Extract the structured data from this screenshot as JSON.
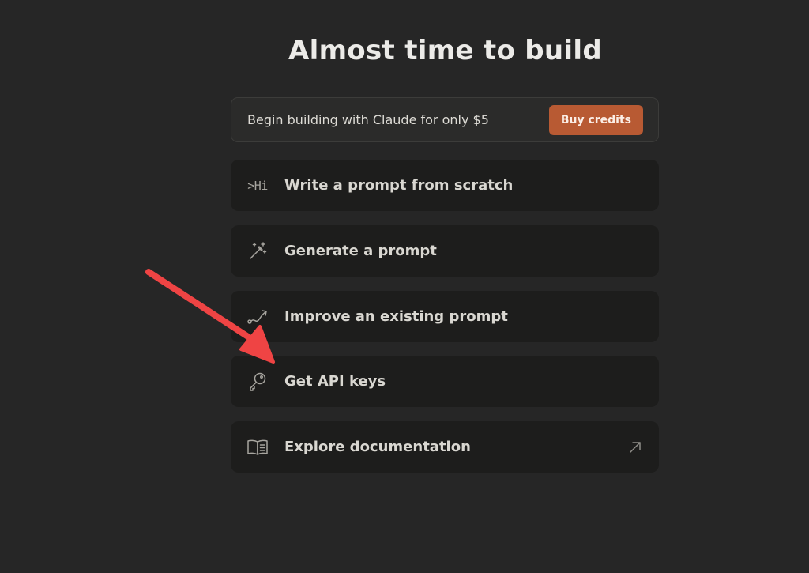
{
  "header": {
    "title": "Almost time to build"
  },
  "credits_banner": {
    "text": "Begin building with Claude for only $5",
    "button_label": "Buy credits",
    "button_color": "#b85a33"
  },
  "actions": [
    {
      "label": "Write a prompt from scratch",
      "icon": "terminal-hi-icon",
      "icon_text": ">Hi"
    },
    {
      "label": "Generate a prompt",
      "icon": "magic-wand-icon"
    },
    {
      "label": "Improve an existing prompt",
      "icon": "curve-path-icon"
    },
    {
      "label": "Get API keys",
      "icon": "key-icon"
    },
    {
      "label": "Explore documentation",
      "icon": "book-icon",
      "trailing_icon": "external-arrow-icon"
    }
  ],
  "annotation": {
    "type": "arrow",
    "color": "#ef4444",
    "points_to": "Get API keys"
  },
  "colors": {
    "background": "#262626",
    "card": "#1d1d1c",
    "accent": "#b85a33"
  }
}
